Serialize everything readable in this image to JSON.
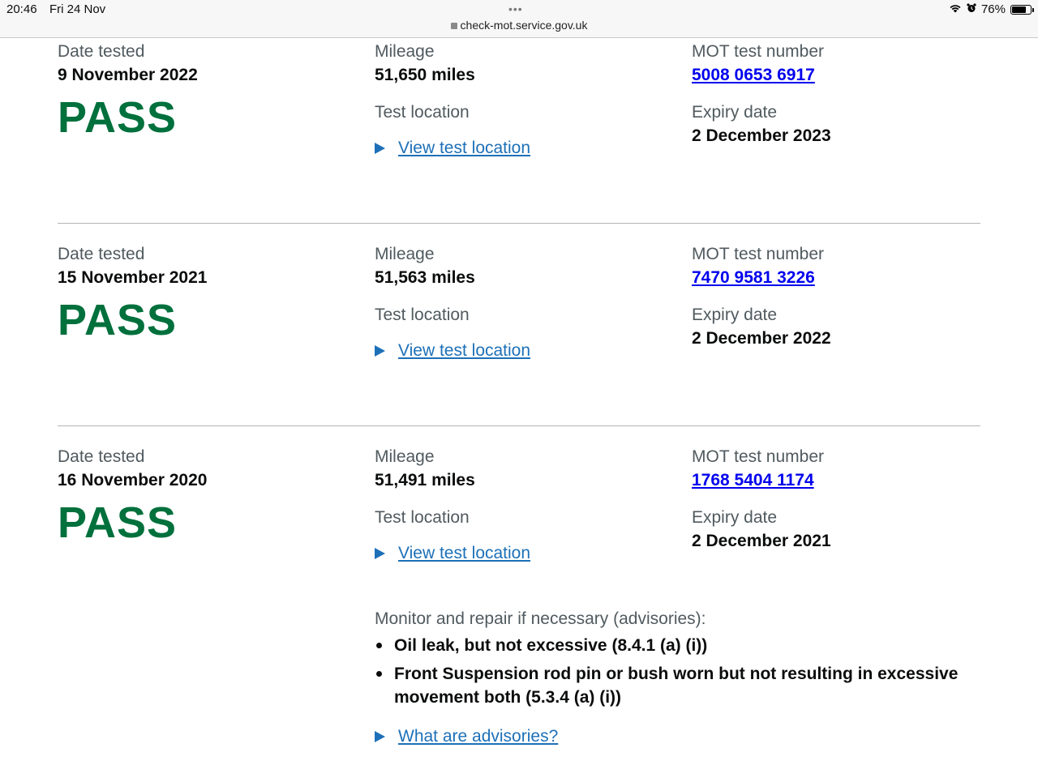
{
  "status_bar": {
    "time": "20:46",
    "date": "Fri 24 Nov",
    "url": "check-mot.service.gov.uk",
    "battery": "76%",
    "battery_level": 0.76,
    "dots": "•••"
  },
  "labels": {
    "date_tested": "Date tested",
    "mileage": "Mileage",
    "mot_test_number": "MOT test number",
    "test_location": "Test location",
    "expiry_date": "Expiry date",
    "view_test_location": "View test location"
  },
  "records": [
    {
      "date_tested": "9 November 2022",
      "result": "PASS",
      "mileage": "51,650 miles",
      "mot_test_number": "5008 0653 6917",
      "expiry_date": "2 December 2023"
    },
    {
      "date_tested": "15 November 2021",
      "result": "PASS",
      "mileage": "51,563 miles",
      "mot_test_number": "7470 9581 3226",
      "expiry_date": "2 December 2022"
    },
    {
      "date_tested": "16 November 2020",
      "result": "PASS",
      "mileage": "51,491 miles",
      "mot_test_number": "1768 5404 1174",
      "expiry_date": "2 December 2021"
    }
  ],
  "advisories": {
    "heading": "Monitor and repair if necessary (advisories):",
    "items": [
      "Oil leak, but not excessive (8.4.1 (a) (i))",
      "Front Suspension rod pin or bush worn but not resulting in excessive movement both (5.3.4 (a) (i))"
    ],
    "link": "What are advisories?"
  },
  "colors": {
    "pass_green": "#00703c",
    "link_blue": "#1d70b8",
    "mot_link_blue": "#0000ee",
    "label_grey": "#505a5f"
  }
}
